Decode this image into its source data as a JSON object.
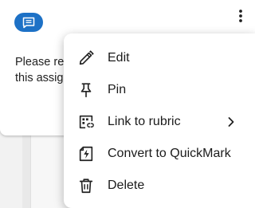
{
  "comment": {
    "badge_icon": "comment-icon",
    "text_line1": "Please re",
    "text_line2": "this assig"
  },
  "kebab_icon": "more-vert-icon",
  "menu": {
    "items": [
      {
        "label": "Edit",
        "icon": "pencil-icon"
      },
      {
        "label": "Pin",
        "icon": "pin-icon"
      },
      {
        "label": "Link to rubric",
        "icon": "rubric-link-icon",
        "has_submenu": true
      },
      {
        "label": "Convert to QuickMark",
        "icon": "quickmark-icon"
      },
      {
        "label": "Delete",
        "icon": "trash-icon"
      }
    ]
  },
  "colors": {
    "accent": "#1d71c6",
    "icon": "#222222"
  }
}
